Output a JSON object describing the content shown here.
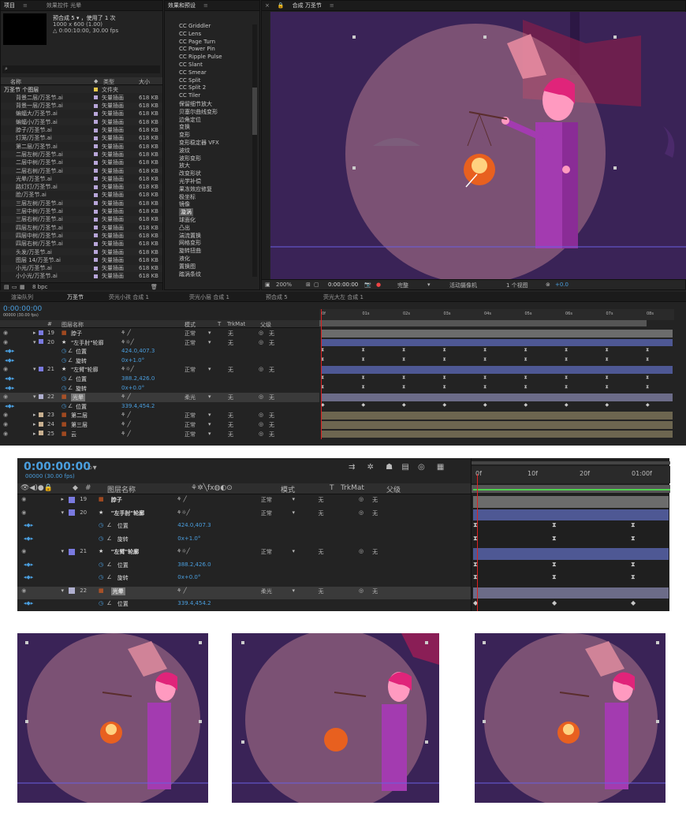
{
  "project": {
    "tab": "项目",
    "tab2": "效果控件 光晕",
    "comp_name": "预合成 5",
    "comp_used": "，使用了 1 次",
    "comp_size": "1000 x 600 (1.00)",
    "comp_duration": "△ 0:00:10:00, 30.00 fps",
    "col_name": "名称",
    "col_type": "类型",
    "col_size": "大小",
    "items": [
      {
        "name": "万圣节 个图层",
        "type": "文件夹",
        "size": "",
        "color": "#e8c84a"
      },
      {
        "name": "背景二层/万圣节.ai",
        "type": "矢量插画",
        "size": "618 KB",
        "color": "#b8a6d9"
      },
      {
        "name": "背景一层/万圣节.ai",
        "type": "矢量插画",
        "size": "618 KB",
        "color": "#b8a6d9"
      },
      {
        "name": "蝙蝠大/万圣节.ai",
        "type": "矢量插画",
        "size": "618 KB",
        "color": "#b8a6d9"
      },
      {
        "name": "蝙蝠小/万圣节.ai",
        "type": "矢量插画",
        "size": "618 KB",
        "color": "#b8a6d9"
      },
      {
        "name": "脖子/万圣节.ai",
        "type": "矢量插画",
        "size": "618 KB",
        "color": "#b8a6d9"
      },
      {
        "name": "灯笼/万圣节.ai",
        "type": "矢量插画",
        "size": "618 KB",
        "color": "#b8a6d9"
      },
      {
        "name": "第二层/万圣节.ai",
        "type": "矢量插画",
        "size": "618 KB",
        "color": "#b8a6d9"
      },
      {
        "name": "二层左树/万圣节.ai",
        "type": "矢量插画",
        "size": "618 KB",
        "color": "#b8a6d9"
      },
      {
        "name": "二层中树/万圣节.ai",
        "type": "矢量插画",
        "size": "618 KB",
        "color": "#b8a6d9"
      },
      {
        "name": "二层右树/万圣节.ai",
        "type": "矢量插画",
        "size": "618 KB",
        "color": "#b8a6d9"
      },
      {
        "name": "光晕/万圣节.ai",
        "type": "矢量插画",
        "size": "618 KB",
        "color": "#b8a6d9"
      },
      {
        "name": "路灯灯/万圣节.ai",
        "type": "矢量插画",
        "size": "618 KB",
        "color": "#b8a6d9"
      },
      {
        "name": "脸/万圣节.ai",
        "type": "矢量插画",
        "size": "618 KB",
        "color": "#b8a6d9"
      },
      {
        "name": "三层左树/万圣节.ai",
        "type": "矢量插画",
        "size": "618 KB",
        "color": "#b8a6d9"
      },
      {
        "name": "三层中树/万圣节.ai",
        "type": "矢量插画",
        "size": "618 KB",
        "color": "#b8a6d9"
      },
      {
        "name": "三层右树/万圣节.ai",
        "type": "矢量插画",
        "size": "618 KB",
        "color": "#b8a6d9"
      },
      {
        "name": "四层左树/万圣节.ai",
        "type": "矢量插画",
        "size": "618 KB",
        "color": "#b8a6d9"
      },
      {
        "name": "四层中树/万圣节.ai",
        "type": "矢量插画",
        "size": "618 KB",
        "color": "#b8a6d9"
      },
      {
        "name": "四层右树/万圣节.ai",
        "type": "矢量插画",
        "size": "618 KB",
        "color": "#b8a6d9"
      },
      {
        "name": "头发/万圣节.ai",
        "type": "矢量插画",
        "size": "618 KB",
        "color": "#b8a6d9"
      },
      {
        "name": "图层 14/万圣节.ai",
        "type": "矢量插画",
        "size": "618 KB",
        "color": "#b8a6d9"
      },
      {
        "name": "小光/万圣节.ai",
        "type": "矢量插画",
        "size": "618 KB",
        "color": "#b8a6d9"
      },
      {
        "name": "小小光/万圣节.ai",
        "type": "矢量插画",
        "size": "618 KB",
        "color": "#b8a6d9"
      }
    ],
    "bpc": "8 bpc"
  },
  "effects": {
    "tab": "效果和预设",
    "items": [
      "CC Griddler",
      "CC Lens",
      "CC Page Turn",
      "CC Power Pin",
      "CC Ripple Pulse",
      "CC Slant",
      "CC Smear",
      "CC Split",
      "CC Split 2",
      "CC Tiler",
      "保留细节放大",
      "贝塞尔曲线变形",
      "边角定位",
      "变换",
      "变形",
      "变形稳定器 VFX",
      "波纹",
      "波形变形",
      "放大",
      "改变形状",
      "光学补偿",
      "果冻效应修复",
      "极坐标",
      "镜像",
      "漩涡",
      "球面化",
      "凸出",
      "湍流置换",
      "网格变形",
      "旋转扭曲",
      "液化",
      "置换图",
      "踏涡条纹"
    ],
    "selected_index": 24
  },
  "viewer": {
    "tab": "合成 万圣节",
    "breadcrumb": "万圣节",
    "zoom": "200%",
    "timecode": "0:00:00:00",
    "quality": "完整",
    "camera": "活动摄像机",
    "views": "1 个视图",
    "exposure": "+0.0"
  },
  "timeline_tabs": [
    "渲染队列",
    "万圣节",
    "荧光小孩 合成 1",
    "荧光小层 合成 1",
    "预合成 5",
    "荧光大左 合成 1"
  ],
  "timeline": {
    "timecode": "0:00:00:00",
    "fps_info": "00000 (30.00 fps)",
    "col_num": "#",
    "col_name": "图层名称",
    "col_mode": "模式",
    "col_t": "T",
    "col_trkmat": "TrkMat",
    "col_parent": "父级",
    "ticks": [
      "0f",
      "01s",
      "02s",
      "03s",
      "04s",
      "05s",
      "06s",
      "07s",
      "08s"
    ],
    "zoom_ticks": [
      "0f",
      "10f",
      "20f",
      "01:00f"
    ],
    "layers": [
      {
        "kind": "layer",
        "num": "19",
        "name": "脖子",
        "mode": "正常",
        "trk": "无",
        "parent": "无",
        "color": "#7a7ae0",
        "bar": "#6c6c6c"
      },
      {
        "kind": "layer",
        "num": "20",
        "name": "\"左手肘\"轮廓",
        "mode": "正常",
        "trk": "无",
        "parent": "无",
        "color": "#7a7ae0",
        "bar": "#4e5894",
        "star": true
      },
      {
        "kind": "prop",
        "name": "位置",
        "value": "424.0,407.3"
      },
      {
        "kind": "prop",
        "name": "旋转",
        "value": "0x+1.0°"
      },
      {
        "kind": "layer",
        "num": "21",
        "name": "\"左臂\"轮廓",
        "mode": "正常",
        "trk": "无",
        "parent": "无",
        "color": "#7a7ae0",
        "bar": "#4e5894",
        "star": true
      },
      {
        "kind": "prop",
        "name": "位置",
        "value": "388.2,426.0"
      },
      {
        "kind": "prop",
        "name": "旋转",
        "value": "0x+0.0°"
      },
      {
        "kind": "layer",
        "num": "22",
        "name": "光晕",
        "mode": "柔光",
        "trk": "无",
        "parent": "无",
        "color": "#b0b0d0",
        "bar": "#6c6c88",
        "selected": true
      },
      {
        "kind": "prop",
        "name": "位置",
        "value": "339.4,454.2"
      },
      {
        "kind": "layer",
        "num": "23",
        "name": "第二层",
        "mode": "正常",
        "trk": "无",
        "parent": "无",
        "color": "#c8b090",
        "bar": "#6d6650"
      },
      {
        "kind": "layer",
        "num": "24",
        "name": "第三层",
        "mode": "正常",
        "trk": "无",
        "parent": "无",
        "color": "#c8b090",
        "bar": "#6d6650"
      },
      {
        "kind": "layer",
        "num": "25",
        "name": "云",
        "mode": "正常",
        "trk": "无",
        "parent": "无",
        "color": "#c8b090",
        "bar": "#6d6650"
      }
    ]
  }
}
